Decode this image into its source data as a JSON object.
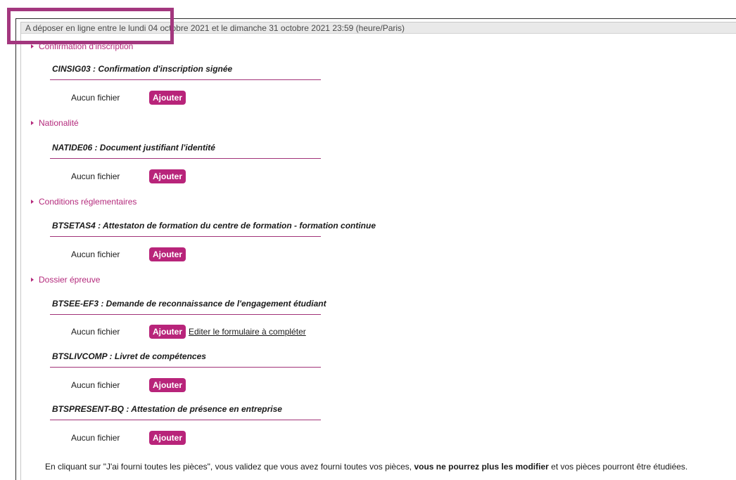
{
  "deadline": "A déposer en ligne entre le lundi 04 octobre 2021 et le dimanche 31 octobre 2021 23:59 (heure/Paris)",
  "sections": [
    {
      "label": "Confirmation d'inscription",
      "documents": [
        {
          "title": "CINSIG03 : Confirmation d'inscription signée",
          "status": "Aucun fichier",
          "button": "Ajouter"
        }
      ]
    },
    {
      "label": "Nationalité",
      "documents": [
        {
          "title": "NATIDE06 : Document justifiant l'identité",
          "status": "Aucun fichier",
          "button": "Ajouter"
        }
      ]
    },
    {
      "label": "Conditions réglementaires",
      "documents": [
        {
          "title": "BTSETAS4 : Attestaton de formation du centre de formation - formation continue",
          "status": "Aucun fichier",
          "button": "Ajouter"
        }
      ]
    },
    {
      "label": "Dossier épreuve",
      "documents": [
        {
          "title": "BTSEE-EF3 : Demande de reconnaissance de l'engagement étudiant",
          "status": "Aucun fichier",
          "button": "Ajouter",
          "link": "Editer le formulaire à compléter"
        },
        {
          "title": "BTSLIVCOMP : Livret de compétences",
          "status": "Aucun fichier",
          "button": "Ajouter"
        },
        {
          "title": "BTSPRESENT-BQ : Attestation de présence en entreprise",
          "status": "Aucun fichier",
          "button": "Ajouter"
        }
      ]
    }
  ],
  "footer": {
    "part1": "En cliquant sur \"J'ai fourni toutes les pièces\", vous validez que vous avez fourni toutes vos pièces, ",
    "bold": "vous ne pourrez plus les modifier",
    "part2": " et vos pièces pourront être étudiées."
  },
  "colors": {
    "accent": "#b8247a",
    "highlight": "#a3377e",
    "section_text": "#b42a7c"
  }
}
